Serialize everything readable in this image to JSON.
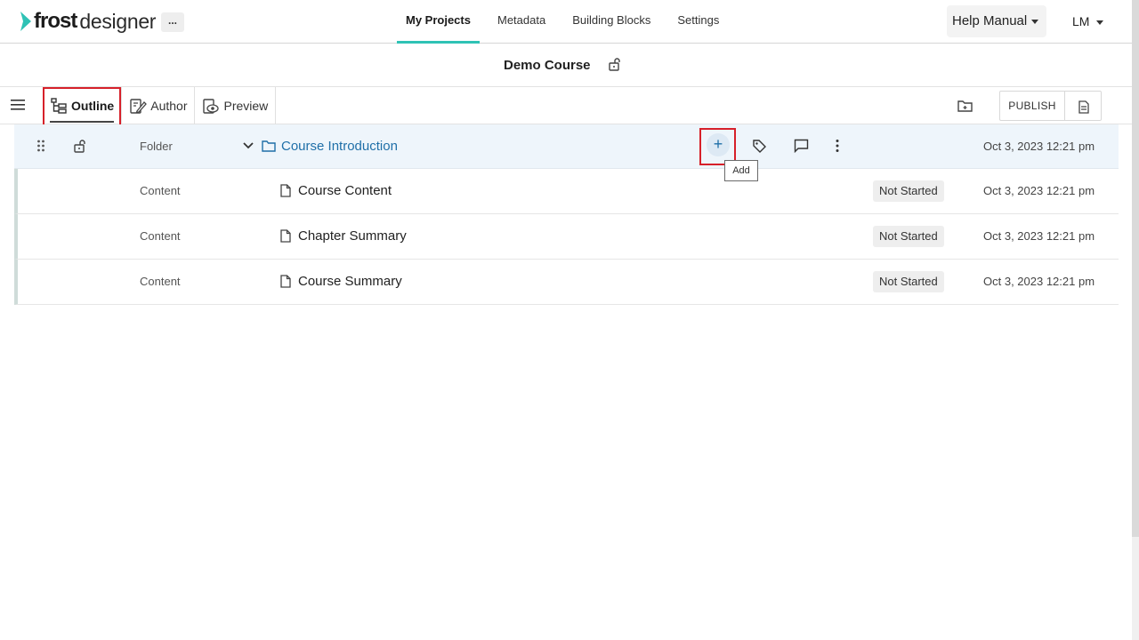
{
  "app": {
    "logo_frost": "frost",
    "logo_designer": "designer",
    "more_label": "..."
  },
  "nav": {
    "items": [
      {
        "label": "My Projects",
        "active": true
      },
      {
        "label": "Metadata"
      },
      {
        "label": "Building Blocks"
      },
      {
        "label": "Settings"
      }
    ],
    "help_label": "Help Manual",
    "user_initials": "LM"
  },
  "course": {
    "title": "Demo Course"
  },
  "toolbar": {
    "tabs": [
      {
        "label": "Outline",
        "active": true
      },
      {
        "label": "Author"
      },
      {
        "label": "Preview"
      }
    ],
    "publish_label": "PUBLISH"
  },
  "outline": {
    "folder": {
      "type": "Folder",
      "name": "Course Introduction",
      "date": "Oct 3, 2023 12:21 pm",
      "add_label": "+",
      "tooltip": "Add"
    },
    "items": [
      {
        "type": "Content",
        "name": "Course Content",
        "status": "Not Started",
        "date": "Oct 3, 2023 12:21 pm"
      },
      {
        "type": "Content",
        "name": "Chapter Summary",
        "status": "Not Started",
        "date": "Oct 3, 2023 12:21 pm"
      },
      {
        "type": "Content",
        "name": "Course Summary",
        "status": "Not Started",
        "date": "Oct 3, 2023 12:21 pm"
      }
    ]
  },
  "colors": {
    "accent": "#2fc2b5",
    "link": "#1f6fa8",
    "highlight": "#d6202a"
  }
}
